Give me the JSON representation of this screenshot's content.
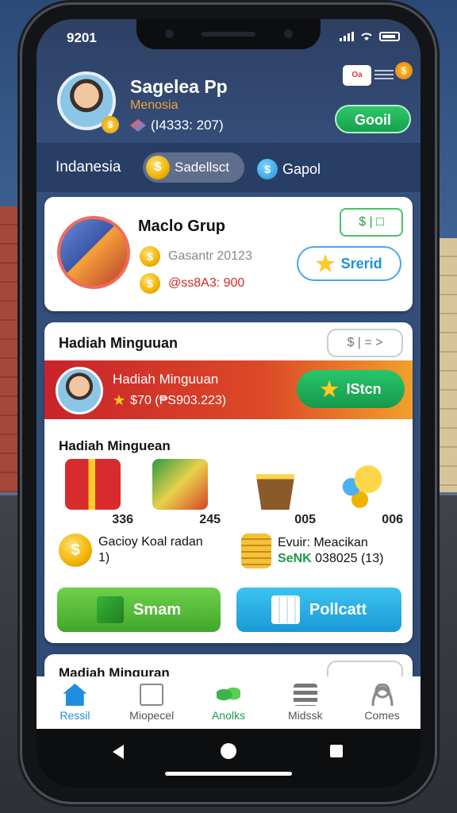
{
  "status": {
    "time": "9201"
  },
  "profile": {
    "name": "Sagelea Pp",
    "subtitle": "Menosia",
    "id_text": "(I4333: 207)",
    "goal_button": "Gooil",
    "cart_badge": "Oa"
  },
  "region": {
    "label": "Indanesia",
    "pill": "Sadellsct",
    "alt": "Gapol"
  },
  "card1": {
    "title": "Maclo Grup",
    "line1": "Gasantr 20123",
    "line2": "@ss8A3: 900",
    "mini_box": "$ | □",
    "spend_button": "Srerid"
  },
  "card2": {
    "title": "Hadiah Minguuan",
    "filter": "$ | = >",
    "banner_title": "Hadiah Minguuan",
    "banner_line": "$70 (₱S903.223)",
    "banner_button": "IStcn",
    "rewards_title": "Hadiah Minguean",
    "items": [
      {
        "name": "gift-box",
        "value": "336"
      },
      {
        "name": "crate",
        "value": "245"
      },
      {
        "name": "mine-cart",
        "value": "005"
      },
      {
        "name": "coins",
        "value": "006"
      }
    ],
    "info_left_l1": "Gacioy Koal radan",
    "info_left_l2": "1)",
    "info_right_l1": "Evuir: Meacikan",
    "info_right_green": "SeNK",
    "info_right_rest": "038025 (13)",
    "btn_left": "Smam",
    "btn_right": "Pollcatt"
  },
  "card3": {
    "title": "Madiah Minguran"
  },
  "nav": [
    {
      "label": "Ressil",
      "icon": "home-icon",
      "active": true
    },
    {
      "label": "Miopecel",
      "icon": "box-icon",
      "active": false
    },
    {
      "label": "Anolks",
      "icon": "leaf-icon",
      "active": false
    },
    {
      "label": "Midssk",
      "icon": "stack-icon",
      "active": false
    },
    {
      "label": "Comes",
      "icon": "user-icon",
      "active": false
    }
  ],
  "colors": {
    "accent": "#1e8fe0",
    "green": "#1fa552",
    "red": "#d02a2a",
    "banner": "#c8232a"
  }
}
